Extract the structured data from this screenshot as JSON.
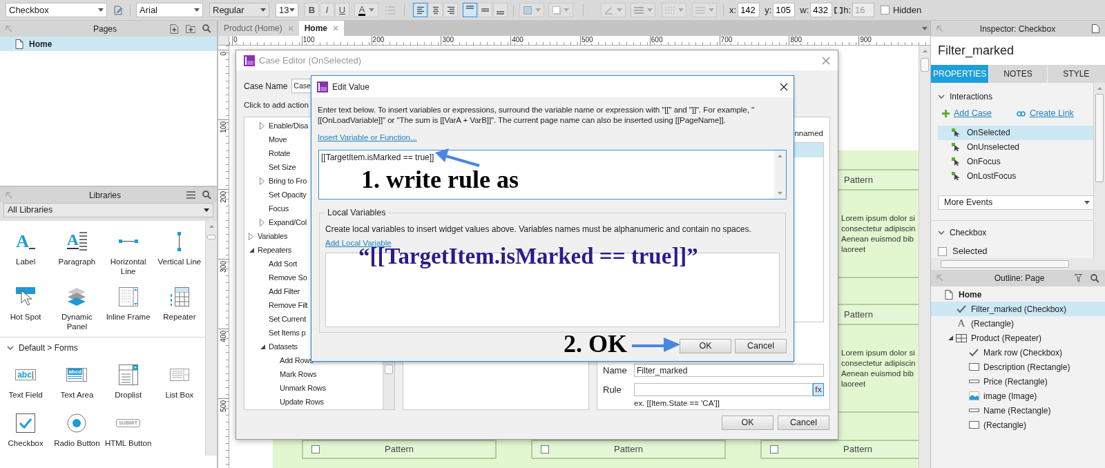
{
  "toolbar": {
    "widget_type": "Checkbox",
    "font_family": "Arial",
    "font_weight": "Regular",
    "font_size": "13",
    "bold": "B",
    "italic": "I",
    "underline": "U",
    "font_color": "A",
    "text_align": [
      {
        "kind": "left",
        "selected": true
      },
      {
        "kind": "center",
        "selected": false
      },
      {
        "kind": "right",
        "selected": false
      }
    ],
    "vertical_align": [
      {
        "kind": "top",
        "selected": true
      },
      {
        "kind": "middle",
        "selected": false
      },
      {
        "kind": "bottom",
        "selected": false
      }
    ],
    "geometry": [
      {
        "label": "x:",
        "value": "142",
        "disabled": false
      },
      {
        "label": "y:",
        "value": "105",
        "disabled": false
      },
      {
        "label": "w:",
        "value": "432",
        "disabled": false
      },
      {
        "label": "h:",
        "value": "16",
        "disabled": true
      }
    ],
    "hidden": {
      "label": "Hidden",
      "checked": false
    }
  },
  "pages": {
    "title": "Pages",
    "items": [
      {
        "label": "Home",
        "selected": true
      }
    ]
  },
  "libraries": {
    "title": "Libraries",
    "filter": "All Libraries",
    "widgets": [
      {
        "kind": "label",
        "label": "Label",
        "glyph": "A"
      },
      {
        "kind": "paragraph",
        "label": "Paragraph",
        "glyph": "A"
      },
      {
        "kind": "hline",
        "label": "Horizontal Line"
      },
      {
        "kind": "vline",
        "label": "Vertical Line"
      },
      {
        "kind": "hotspot",
        "label": "Hot Spot"
      },
      {
        "kind": "dynamic_panel",
        "label": "Dynamic Panel"
      },
      {
        "kind": "inline_frame",
        "label": "Inline Frame"
      },
      {
        "kind": "repeater",
        "label": "Repeater"
      }
    ],
    "sections": [
      {
        "title": "Default > Forms",
        "expanded": true,
        "widgets": [
          {
            "kind": "text_field",
            "label": "Text Field",
            "glyph": "abc"
          },
          {
            "kind": "text_area",
            "label": "Text Area",
            "glyph": "abcd"
          },
          {
            "kind": "droplist",
            "label": "Droplist"
          },
          {
            "kind": "list_box",
            "label": "List Box"
          },
          {
            "kind": "checkbox",
            "label": "Checkbox"
          },
          {
            "kind": "radio",
            "label": "Radio Button"
          },
          {
            "kind": "html_button",
            "label": "HTML Button",
            "glyph": "SUBMIT"
          }
        ]
      }
    ]
  },
  "tabs": [
    {
      "label": "Product (Home)",
      "selected": false
    },
    {
      "label": "Home",
      "selected": true
    }
  ],
  "ruler": {
    "x_labels": [
      "0",
      "100",
      "200",
      "300",
      "400",
      "500",
      "600",
      "700",
      "800",
      "900"
    ],
    "y_labels": [
      "0",
      "100",
      "200",
      "300",
      "400",
      "500"
    ]
  },
  "repeater": {
    "right_cells": [
      {
        "header": "Pattern",
        "lines": [
          "Lorem ipsum dolor si",
          "consectetur adipiscin",
          "Aenean euismod bib",
          "laoreet"
        ]
      },
      {
        "header": "Pattern",
        "lines": [
          "Lorem ipsum dolor si",
          "consectetur adipiscin",
          "Aenean euismod bib",
          "laoreet"
        ]
      }
    ],
    "bottom_items": [
      {
        "header": "Pattern",
        "checked": false
      },
      {
        "header": "Pattern",
        "checked": false
      },
      {
        "header": "Pattern",
        "checked": false
      }
    ]
  },
  "case_editor": {
    "title": "Case Editor (OnSelected)",
    "case_name_label": "Case Name",
    "case_name": "Case",
    "instruction": "Click to add action",
    "action_tree": [
      {
        "children": [
          {
            "label": "Enable/Disa",
            "expanded": false
          },
          {
            "label": "Move"
          },
          {
            "label": "Rotate"
          },
          {
            "label": "Set Size"
          },
          {
            "label": "Bring to Fro",
            "expanded": false
          },
          {
            "label": "Set Opacity"
          },
          {
            "label": "Focus"
          },
          {
            "label": "Expand/Col",
            "expanded": false
          }
        ]
      },
      {
        "label": "Variables",
        "expanded": false
      },
      {
        "label": "Repeaters",
        "expanded": true,
        "children": [
          {
            "label": "Add Sort"
          },
          {
            "label": "Remove So"
          },
          {
            "label": "Add Filter"
          },
          {
            "label": "Remove Filt"
          },
          {
            "label": "Set Current"
          },
          {
            "label": "Set Items p"
          },
          {
            "label": "Datasets",
            "expanded": true,
            "children": [
              {
                "label": "Add Rows"
              },
              {
                "label": "Mark Rows"
              },
              {
                "label": "Unmark Rows"
              },
              {
                "label": "Update Rows"
              }
            ]
          }
        ]
      }
    ],
    "condition_header": "nnamed",
    "list_rows": [
      {
        "selected": true
      }
    ],
    "name_label": "Name",
    "name_value": "Filter_marked",
    "rule_label": "Rule",
    "rule_button": "fx",
    "rule_hint": "ex. [[Item.State == 'CA']]",
    "ok": "OK",
    "cancel": "Cancel"
  },
  "edit_value": {
    "title": "Edit Value",
    "description": "Enter text below. To insert variables or expressions, surround the variable name or expression with \"[[\" and \"]]\". For example, \"[[OnLoadVariable]]\" or \"The sum is [[VarA + VarB]]\". The current page name can also be inserted using [[PageName]].",
    "insert_link": "Insert Variable or Function...",
    "value": "[[TargetItem.isMarked == true]]",
    "local_variables": {
      "title": "Local Variables",
      "description": "Create local variables to insert widget values above. Variables names must be alphanumeric and contain no spaces.",
      "add_link": "Add Local Variable"
    },
    "ok": "OK",
    "cancel": "Cancel"
  },
  "annotations": [
    {
      "kind": "step",
      "text": "1. write rule as"
    },
    {
      "kind": "quote",
      "text": "“[[TargetItem.isMarked == true]]”"
    },
    {
      "kind": "step",
      "text": "2. OK"
    }
  ],
  "inspector": {
    "title": "Inspector: Checkbox",
    "widget_name": "Filter_marked",
    "tabs": [
      {
        "label": "PROPERTIES",
        "selected": true
      },
      {
        "label": "NOTES",
        "selected": false
      },
      {
        "label": "STYLE",
        "selected": false
      }
    ],
    "interactions": {
      "title": "Interactions",
      "expanded": true,
      "add_case": "Add Case",
      "create_link": "Create Link",
      "events": [
        {
          "label": "OnSelected",
          "selected": true
        },
        {
          "label": "OnUnselected",
          "selected": false
        },
        {
          "label": "OnFocus",
          "selected": false
        },
        {
          "label": "OnLostFocus",
          "selected": false
        }
      ],
      "more_events": "More Events"
    },
    "checkbox_section": {
      "title": "Checkbox",
      "expanded": true,
      "option": {
        "label": "Selected",
        "checked": false
      }
    }
  },
  "outline": {
    "title": "Outline: Page",
    "tree": [
      {
        "kind": "page",
        "label": "Home",
        "selected": false,
        "children": [
          {
            "kind": "checkbox",
            "label": "Filter_marked (Checkbox)",
            "selected": true
          },
          {
            "kind": "text",
            "label": "(Rectangle)",
            "glyph": "A",
            "selected": false
          },
          {
            "kind": "repeater",
            "label": "Product (Repeater)",
            "selected": false,
            "expanded": true,
            "children": [
              {
                "kind": "checkbox",
                "label": "Mark row (Checkbox)",
                "selected": false
              },
              {
                "kind": "rectangle",
                "label": "Description (Rectangle)",
                "selected": false
              },
              {
                "kind": "line",
                "label": "Price (Rectangle)",
                "selected": false
              },
              {
                "kind": "image",
                "label": "image (Image)",
                "selected": false
              },
              {
                "kind": "line",
                "label": "Name (Rectangle)",
                "selected": false
              },
              {
                "kind": "rectangle",
                "label": "(Rectangle)",
                "selected": false
              }
            ]
          }
        ]
      }
    ]
  }
}
